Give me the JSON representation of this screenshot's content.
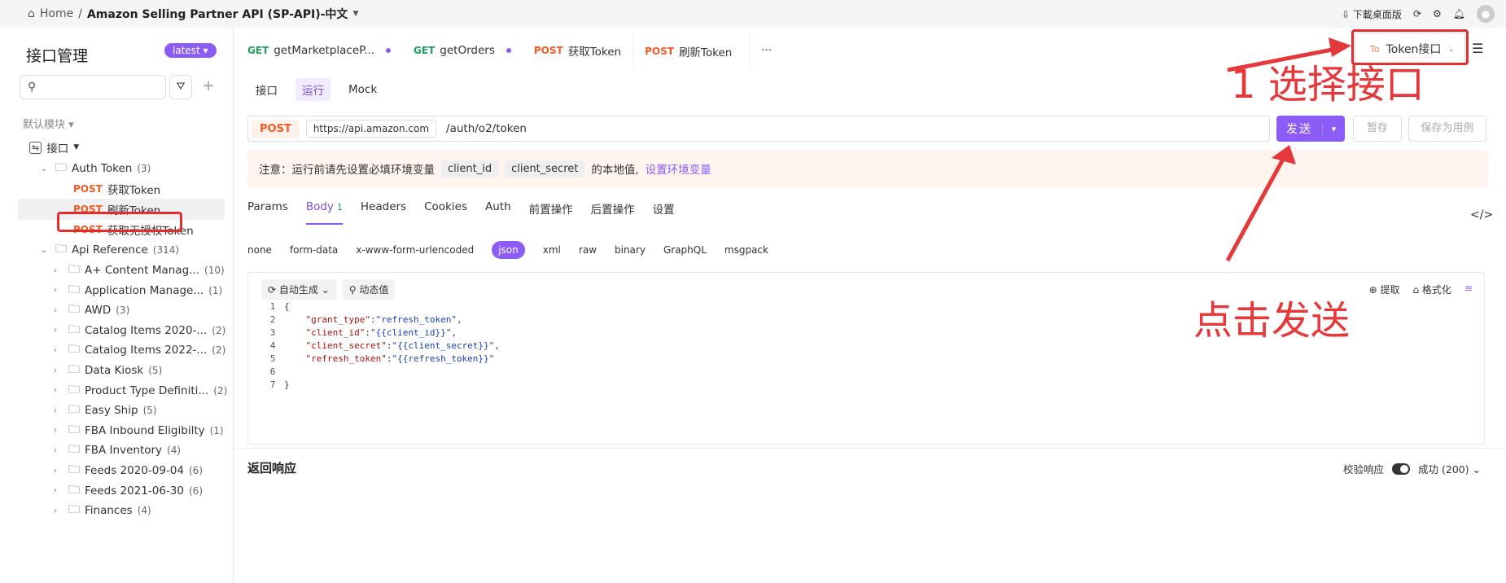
{
  "topbar": {
    "home": "Home",
    "separator": "/",
    "project": "Amazon Selling Partner API (SP-API)-中文",
    "download": "下載桌面版"
  },
  "sidebar": {
    "title": "接口管理",
    "version": "latest",
    "module": "默认模块",
    "root": "接口",
    "items": [
      {
        "label": "Auth Token",
        "count": "(3)"
      },
      {
        "method": "POST",
        "label": "获取Token"
      },
      {
        "method": "POST",
        "label": "刷新Token"
      },
      {
        "method": "POST",
        "label": "获取无授权Token"
      },
      {
        "label": "Api Reference",
        "count": "(314)"
      },
      {
        "label": "A+ Content Manag...",
        "count": "(10)"
      },
      {
        "label": "Application Manage...",
        "count": "(1)"
      },
      {
        "label": "AWD",
        "count": "(3)"
      },
      {
        "label": "Catalog Items 2020-...",
        "count": "(2)"
      },
      {
        "label": "Catalog Items 2022-...",
        "count": "(2)"
      },
      {
        "label": "Data Kiosk",
        "count": "(5)"
      },
      {
        "label": "Product Type Definiti...",
        "count": "(2)"
      },
      {
        "label": "Easy Ship",
        "count": "(5)"
      },
      {
        "label": "FBA Inbound Eligibilty",
        "count": "(1)"
      },
      {
        "label": "FBA Inventory",
        "count": "(4)"
      },
      {
        "label": "Feeds 2020-09-04",
        "count": "(6)"
      },
      {
        "label": "Feeds 2021-06-30",
        "count": "(6)"
      },
      {
        "label": "Finances",
        "count": "(4)"
      }
    ]
  },
  "tabs": [
    {
      "method": "GET",
      "label": "getMarketplaceP..."
    },
    {
      "method": "GET",
      "label": "getOrders"
    },
    {
      "method": "POST",
      "label": "获取Token"
    },
    {
      "method": "POST",
      "label": "刷新Token"
    }
  ],
  "tabs_more": "···",
  "env": {
    "tag": "To",
    "label": "Token接口"
  },
  "subtabs": [
    "接口",
    "运行",
    "Mock"
  ],
  "request": {
    "method": "POST",
    "host": "https://api.amazon.com",
    "path": "/auth/o2/token",
    "send": "发送",
    "save": "暂存",
    "save_case": "保存为用例"
  },
  "notice": {
    "prefix": "注意：运行前请先设置必填环境变量",
    "var1": "client_id",
    "var2": "client_secret",
    "suffix": "的本地值,",
    "link": "设置环境变量"
  },
  "param_tabs": [
    {
      "label": "Params"
    },
    {
      "label": "Body",
      "badge": "1"
    },
    {
      "label": "Headers"
    },
    {
      "label": "Cookies"
    },
    {
      "label": "Auth"
    },
    {
      "label": "前置操作"
    },
    {
      "label": "后置操作"
    },
    {
      "label": "设置"
    }
  ],
  "body_types": [
    "none",
    "form-data",
    "x-www-form-urlencoded",
    "json",
    "xml",
    "raw",
    "binary",
    "GraphQL",
    "msgpack"
  ],
  "editor": {
    "auto": "自动生成",
    "dynamic": "动态值",
    "extract": "提取",
    "format": "格式化",
    "lines": [
      {
        "n": "1",
        "t": "{"
      },
      {
        "n": "2",
        "k": "\"grant_type\"",
        "v": "\"refresh_token\","
      },
      {
        "n": "3",
        "k": "\"client_id\"",
        "v": "\"{{client_id}}\","
      },
      {
        "n": "4",
        "k": "\"client_secret\"",
        "v": "\"{{client_secret}}\","
      },
      {
        "n": "5",
        "k": "\"refresh_token\"",
        "v": "\"{{refresh_token}}\""
      },
      {
        "n": "6",
        "t": ""
      },
      {
        "n": "7",
        "t": "}"
      }
    ]
  },
  "response": {
    "title": "返回响应",
    "validate": "校验响应",
    "status": "成功 (200)"
  },
  "annotations": {
    "select": "1 选择接口",
    "send": "点击发送"
  },
  "colors": {
    "accent": "#8b5cf6",
    "post": "#f05a24",
    "get": "#1fa05a",
    "annotation": "#e5383b"
  }
}
